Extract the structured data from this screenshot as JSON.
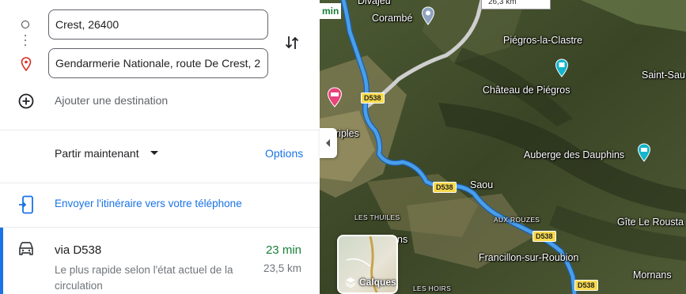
{
  "directions": {
    "origin": "Crest, 26400",
    "destination": "Gendarmerie Nationale, route De Crest, 2",
    "add_destination": "Ajouter une destination",
    "depart_label": "Partir maintenant",
    "options_label": "Options",
    "send_to_phone": "Envoyer l'itinéraire vers votre téléphone"
  },
  "route": {
    "name": "via D538",
    "time": "23 min",
    "description": "Le plus rapide selon l'état actuel de la circulation",
    "distance": "23,5 km"
  },
  "map": {
    "top_distance": "26,3 km",
    "top_left_tag": "min",
    "layers_label": "Calques",
    "places": {
      "divajeu": "Divajeu",
      "corambe": "Corambé",
      "piegros_clastre": "Piégros-la-Clastre",
      "saint_sau": "Saint-Sau",
      "chateau_piegros": "Château de Piégros",
      "auberge": "Auberge des Dauphins",
      "riples": "riples",
      "saou": "Saou",
      "aux_rouzes": "AUX ROUZES",
      "les_thuiles": "LES THUILES",
      "francillon": "Francillon-sur-Roubion",
      "gite": "Gîte Le Rousta",
      "mornans": "Mornans",
      "les_hoirs": "LES HOIRS",
      "ns": "ns"
    },
    "road_shields": [
      "D538",
      "D538",
      "D538",
      "D538"
    ]
  },
  "colors": {
    "route_blue": "#4a9fe8",
    "accent_blue": "#1a73e8",
    "time_green": "#188038",
    "poi_teal": "#12b5cb",
    "poi_pink": "#e8437a",
    "shield_yellow": "#f7d94c"
  }
}
